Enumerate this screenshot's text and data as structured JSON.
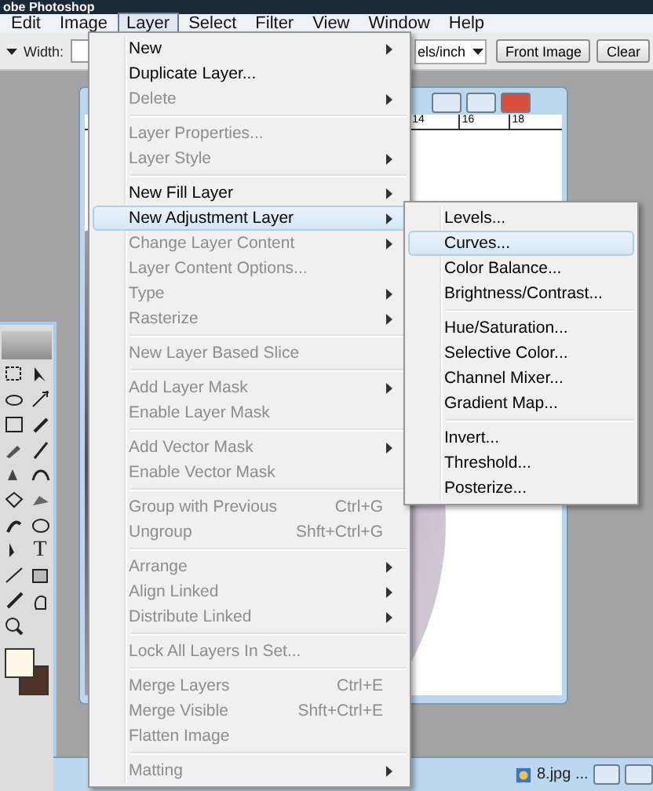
{
  "window": {
    "title": "obe Photoshop"
  },
  "menubar": [
    {
      "label": "Edit",
      "selected": false
    },
    {
      "label": "Image",
      "selected": false
    },
    {
      "label": "Layer",
      "selected": true
    },
    {
      "label": "Select",
      "selected": false
    },
    {
      "label": "Filter",
      "selected": false
    },
    {
      "label": "View",
      "selected": false
    },
    {
      "label": "Window",
      "selected": false
    },
    {
      "label": "Help",
      "selected": false
    }
  ],
  "options_bar": {
    "width_label": "Width:",
    "resolution_unit": "els/inch",
    "buttons": [
      "Front Image",
      "Clear"
    ]
  },
  "document": {
    "ruler_labels": [
      "14",
      "16",
      "18"
    ]
  },
  "toolbox": {
    "type_tool": "T"
  },
  "taskbar": {
    "document": "8.jpg ..."
  },
  "layer_menu": [
    {
      "kind": "item",
      "label": "New",
      "submenu": true,
      "disabled": false,
      "selected": false
    },
    {
      "kind": "item",
      "label": "Duplicate Layer...",
      "submenu": false,
      "disabled": false,
      "selected": false
    },
    {
      "kind": "item",
      "label": "Delete",
      "submenu": true,
      "disabled": true,
      "selected": false
    },
    {
      "kind": "separator"
    },
    {
      "kind": "item",
      "label": "Layer Properties...",
      "submenu": false,
      "disabled": true,
      "selected": false
    },
    {
      "kind": "item",
      "label": "Layer Style",
      "submenu": true,
      "disabled": true,
      "selected": false
    },
    {
      "kind": "separator"
    },
    {
      "kind": "item",
      "label": "New Fill Layer",
      "submenu": true,
      "disabled": false,
      "selected": false
    },
    {
      "kind": "item",
      "label": "New Adjustment Layer",
      "submenu": true,
      "disabled": false,
      "selected": true
    },
    {
      "kind": "item",
      "label": "Change Layer Content",
      "submenu": true,
      "disabled": true,
      "selected": false
    },
    {
      "kind": "item",
      "label": "Layer Content Options...",
      "submenu": false,
      "disabled": true,
      "selected": false
    },
    {
      "kind": "item",
      "label": "Type",
      "submenu": true,
      "disabled": true,
      "selected": false
    },
    {
      "kind": "item",
      "label": "Rasterize",
      "submenu": true,
      "disabled": true,
      "selected": false
    },
    {
      "kind": "separator"
    },
    {
      "kind": "item",
      "label": "New Layer Based Slice",
      "submenu": false,
      "disabled": true,
      "selected": false
    },
    {
      "kind": "separator"
    },
    {
      "kind": "item",
      "label": "Add Layer Mask",
      "submenu": true,
      "disabled": true,
      "selected": false
    },
    {
      "kind": "item",
      "label": "Enable Layer Mask",
      "submenu": false,
      "disabled": true,
      "selected": false
    },
    {
      "kind": "separator"
    },
    {
      "kind": "item",
      "label": "Add Vector Mask",
      "submenu": true,
      "disabled": true,
      "selected": false
    },
    {
      "kind": "item",
      "label": "Enable Vector Mask",
      "submenu": false,
      "disabled": true,
      "selected": false
    },
    {
      "kind": "separator"
    },
    {
      "kind": "item",
      "label": "Group with Previous",
      "shortcut": "Ctrl+G",
      "submenu": false,
      "disabled": true,
      "selected": false
    },
    {
      "kind": "item",
      "label": "Ungroup",
      "shortcut": "Shft+Ctrl+G",
      "submenu": false,
      "disabled": true,
      "selected": false
    },
    {
      "kind": "separator"
    },
    {
      "kind": "item",
      "label": "Arrange",
      "submenu": true,
      "disabled": true,
      "selected": false
    },
    {
      "kind": "item",
      "label": "Align Linked",
      "submenu": true,
      "disabled": true,
      "selected": false
    },
    {
      "kind": "item",
      "label": "Distribute Linked",
      "submenu": true,
      "disabled": true,
      "selected": false
    },
    {
      "kind": "separator"
    },
    {
      "kind": "item",
      "label": "Lock All Layers In Set...",
      "submenu": false,
      "disabled": true,
      "selected": false
    },
    {
      "kind": "separator"
    },
    {
      "kind": "item",
      "label": "Merge Layers",
      "shortcut": "Ctrl+E",
      "submenu": false,
      "disabled": true,
      "selected": false
    },
    {
      "kind": "item",
      "label": "Merge Visible",
      "shortcut": "Shft+Ctrl+E",
      "submenu": false,
      "disabled": true,
      "selected": false
    },
    {
      "kind": "item",
      "label": "Flatten Image",
      "submenu": false,
      "disabled": true,
      "selected": false
    },
    {
      "kind": "separator"
    },
    {
      "kind": "item",
      "label": "Matting",
      "submenu": true,
      "disabled": true,
      "selected": false
    }
  ],
  "adjustment_submenu": [
    {
      "kind": "item",
      "label": "Levels...",
      "selected": false
    },
    {
      "kind": "item",
      "label": "Curves...",
      "selected": true
    },
    {
      "kind": "item",
      "label": "Color Balance...",
      "selected": false
    },
    {
      "kind": "item",
      "label": "Brightness/Contrast...",
      "selected": false
    },
    {
      "kind": "separator"
    },
    {
      "kind": "item",
      "label": "Hue/Saturation...",
      "selected": false
    },
    {
      "kind": "item",
      "label": "Selective Color...",
      "selected": false
    },
    {
      "kind": "item",
      "label": "Channel Mixer...",
      "selected": false
    },
    {
      "kind": "item",
      "label": "Gradient Map...",
      "selected": false
    },
    {
      "kind": "separator"
    },
    {
      "kind": "item",
      "label": "Invert...",
      "selected": false
    },
    {
      "kind": "item",
      "label": "Threshold...",
      "selected": false
    },
    {
      "kind": "item",
      "label": "Posterize...",
      "selected": false
    }
  ]
}
